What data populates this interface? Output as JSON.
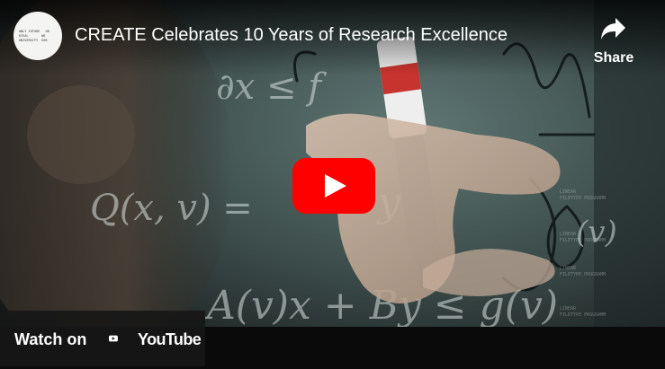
{
  "video": {
    "title": "CREATE Celebrates 10 Years of Research Excellence"
  },
  "channel": {
    "logo_lines": [
      "ONLY FUTURE   OR",
      "RIVAL       WE",
      "UNIVERSITY  ENS"
    ]
  },
  "share": {
    "label": "Share",
    "icon": "share-arrow-icon"
  },
  "play": {
    "icon": "play-icon",
    "color": "#ff0000"
  },
  "watch_on": {
    "label": "Watch on",
    "brand": "YouTube",
    "icon": "youtube-logo-icon"
  },
  "colors": {
    "youtube_red": "#ff0000",
    "overlay": "#171717",
    "text": "#ffffff"
  }
}
